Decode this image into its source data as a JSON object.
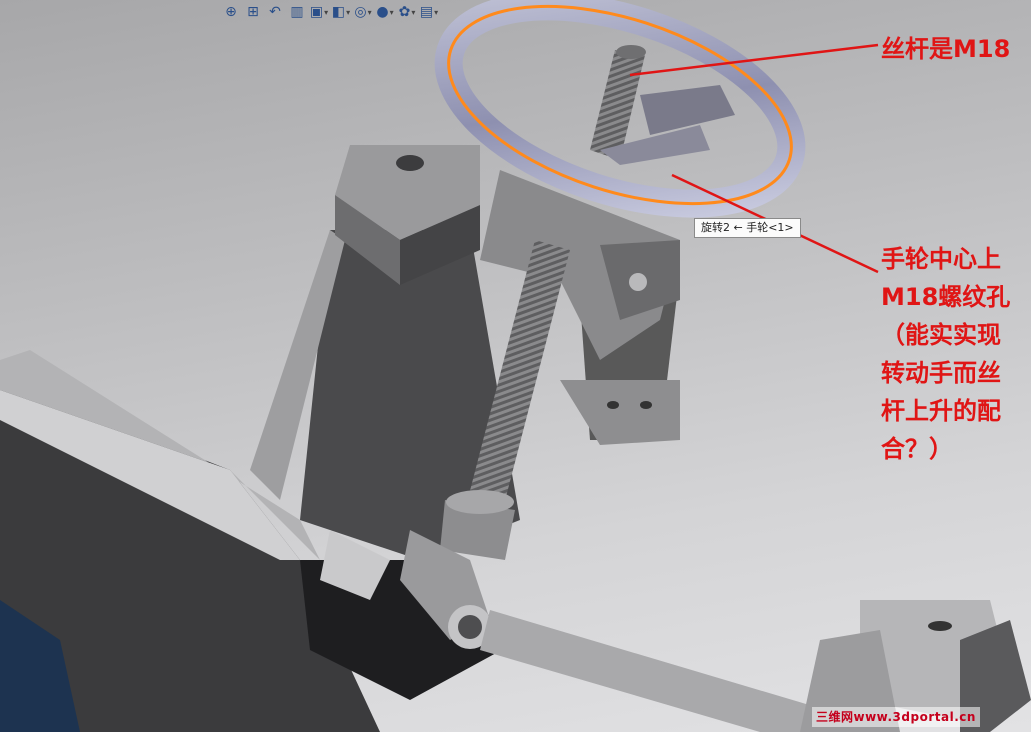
{
  "toolbar": {
    "items": [
      {
        "name": "zoom-to-fit-icon",
        "glyph": "⊕"
      },
      {
        "name": "zoom-area-icon",
        "glyph": "⊞"
      },
      {
        "name": "previous-view-icon",
        "glyph": "↶"
      },
      {
        "name": "section-view-icon",
        "glyph": "▥"
      },
      {
        "name": "view-orientation-icon",
        "glyph": "▣"
      },
      {
        "name": "display-style-icon",
        "glyph": "◧"
      },
      {
        "name": "hide-show-items-icon",
        "glyph": "◎"
      },
      {
        "name": "edit-appearance-icon",
        "glyph": "●"
      },
      {
        "name": "apply-scene-icon",
        "glyph": "✿"
      },
      {
        "name": "view-settings-icon",
        "glyph": "▤"
      }
    ]
  },
  "tooltip": {
    "text": "旋转2 ← 手轮<1>"
  },
  "annotations": {
    "note1": "丝杆是M18",
    "note2_lines": [
      "手轮中心上",
      "M18螺纹孔",
      "（能实实现",
      "转动手而丝",
      "杆上升的配",
      "合？）"
    ]
  },
  "watermark": {
    "text": "三维网www.3dportal.cn"
  },
  "colors": {
    "annotation": "#e01515",
    "highlight": "#ff8a1c"
  }
}
